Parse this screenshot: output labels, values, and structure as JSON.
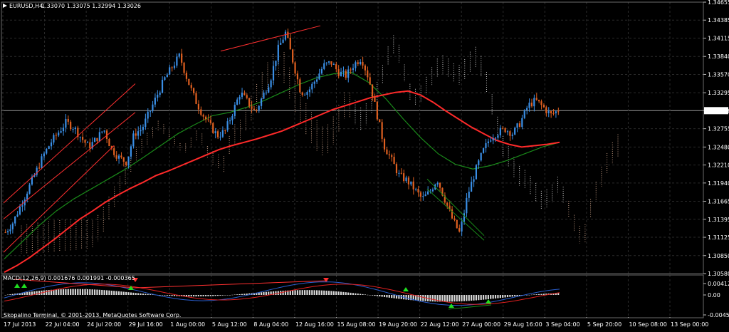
{
  "header": {
    "symbol": "EURUSD,H4",
    "quote": "1.33070 1.33075 1.32994 1.33026"
  },
  "macd_header": "MACD(12,26,9) 0.001676 0.001991 -0.000365",
  "copyright": "Skopalino Terminal, © 2001-2013, MetaQuotes Software Corp.",
  "colors": {
    "background": "#000000",
    "grid": "#2a2a2a",
    "bull_candle": "#3a8fe6",
    "bear_candle": "#e06020",
    "ma_slow": "#ff2a2a",
    "ma_fast": "#1a8a1a",
    "cloud": "#e8b89a",
    "cloud_dark": "#f0f0f0",
    "macd_hist": "#d8d8d8",
    "macd_main": "#2a5fd0",
    "macd_signal": "#e02020",
    "arrow_up": "#20e020",
    "arrow_down": "#ff3030"
  },
  "chart_data": {
    "type": "candlestick",
    "symbol": "EURUSD",
    "timeframe": "H4",
    "current_price": "1.33026",
    "y_ticks": [
      "1.34655",
      "1.34385",
      "1.34115",
      "1.33840",
      "1.33570",
      "1.33295",
      "1.33026",
      "1.32755",
      "1.32480",
      "1.32210",
      "1.31940",
      "1.31665",
      "1.31395",
      "1.31125",
      "1.30850",
      "1.30580"
    ],
    "ylim": [
      1.3058,
      1.34655
    ],
    "x_ticks": [
      "17 Jul 2013",
      "22 Jul 04:00",
      "24 Jul 20:00",
      "29 Jul 16:00",
      "1 Aug 00:00",
      "5 Aug 12:00",
      "8 Aug 04:00",
      "12 Aug 16:00",
      "15 Aug 08:00",
      "19 Aug 20:00",
      "22 Aug 12:00",
      "27 Aug 00:00",
      "29 Aug 16:00",
      "3 Sep 04:00",
      "5 Sep 20:00",
      "10 Sep 08:00",
      "13 Sep 00:00"
    ],
    "price_path": [
      1.312,
      1.3135,
      1.316,
      1.3185,
      1.321,
      1.3235,
      1.3255,
      1.327,
      1.3285,
      1.3278,
      1.3262,
      1.3248,
      1.326,
      1.3275,
      1.3245,
      1.3232,
      1.3225,
      1.3268,
      1.3275,
      1.33,
      1.3325,
      1.335,
      1.3368,
      1.3385,
      1.335,
      1.332,
      1.3298,
      1.328,
      1.3265,
      1.3272,
      1.33,
      1.333,
      1.3315,
      1.33,
      1.3325,
      1.335,
      1.3395,
      1.342,
      1.3375,
      1.333,
      1.3332,
      1.335,
      1.337,
      1.3375,
      1.336,
      1.3355,
      1.3372,
      1.3382,
      1.335,
      1.33,
      1.325,
      1.3228,
      1.3205,
      1.3198,
      1.3185,
      1.317,
      1.318,
      1.32,
      1.317,
      1.314,
      1.3118,
      1.3175,
      1.321,
      1.324,
      1.3262,
      1.327,
      1.3275,
      1.3268,
      1.3285,
      1.331,
      1.3318,
      1.3308,
      1.3296,
      1.3303
    ],
    "ma_slow": [
      1.306,
      1.307,
      1.3082,
      1.3096,
      1.311,
      1.3125,
      1.314,
      1.3152,
      1.3165,
      1.3176,
      1.3186,
      1.3195,
      1.3205,
      1.3212,
      1.322,
      1.3228,
      1.3236,
      1.3244,
      1.325,
      1.3255,
      1.326,
      1.3266,
      1.3272,
      1.328,
      1.3288,
      1.3296,
      1.3304,
      1.331,
      1.3316,
      1.3322,
      1.3326,
      1.333,
      1.3332,
      1.3326,
      1.3315,
      1.3302,
      1.329,
      1.3278,
      1.3268,
      1.3258,
      1.3252,
      1.3248,
      1.325,
      1.3252,
      1.3255
    ],
    "ma_fast": [
      1.308,
      1.3105,
      1.313,
      1.3152,
      1.317,
      1.3185,
      1.32,
      1.3215,
      1.3232,
      1.325,
      1.3268,
      1.3282,
      1.3295,
      1.33,
      1.3308,
      1.3318,
      1.333,
      1.3342,
      1.3352,
      1.3358,
      1.336,
      1.3345,
      1.332,
      1.329,
      1.3262,
      1.3238,
      1.3222,
      1.3215,
      1.322,
      1.3228,
      1.3238,
      1.3248,
      1.3255
    ]
  }
}
